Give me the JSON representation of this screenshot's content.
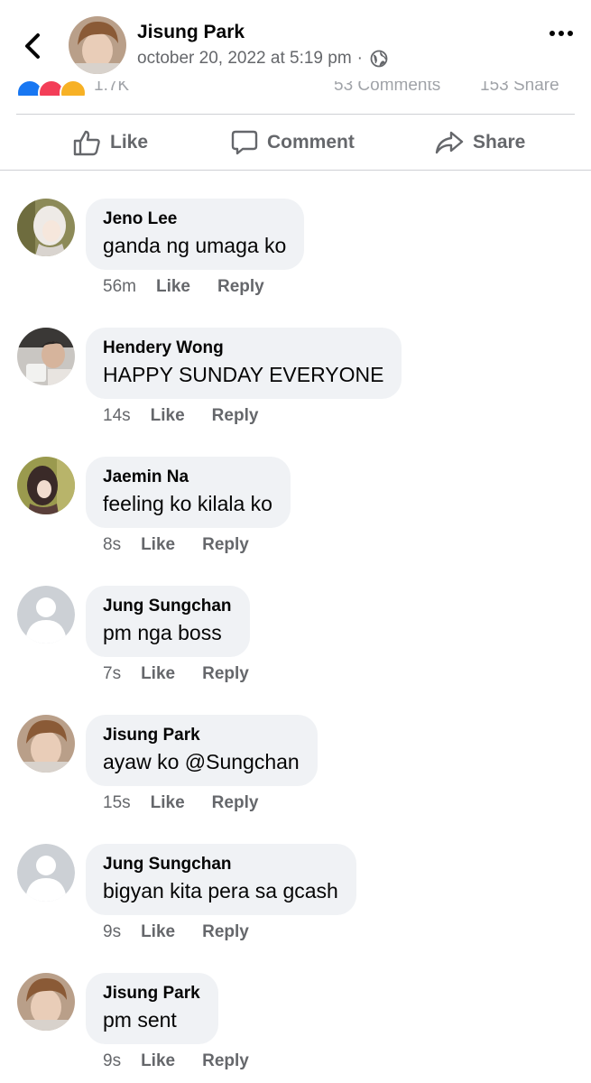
{
  "header": {
    "author": "Jisung Park",
    "timestamp": "october 20, 2022 at 5:19 pm",
    "separator": "·",
    "privacy_icon": "globe-icon"
  },
  "reactions": {
    "left_text": "1.7K",
    "comments_text": "53 Comments",
    "shares_text": "153 Share"
  },
  "actions": [
    {
      "label": "Like",
      "icon": "thumbs-up-icon"
    },
    {
      "label": "Comment",
      "icon": "comment-icon"
    },
    {
      "label": "Share",
      "icon": "share-icon"
    }
  ],
  "comments": [
    {
      "name": "Jeno Lee",
      "text": "ganda ng umaga ko",
      "time": "56m",
      "like": "Like",
      "reply": "Reply"
    },
    {
      "name": "Hendery Wong",
      "text": "HAPPY SUNDAY EVERYONE",
      "time": "14s",
      "like": "Like",
      "reply": "Reply"
    },
    {
      "name": "Jaemin Na",
      "text": "feeling ko kilala ko",
      "time": "8s",
      "like": "Like",
      "reply": "Reply"
    },
    {
      "name": "Jung Sungchan",
      "text": "pm nga boss",
      "time": "7s",
      "like": "Like",
      "reply": "Reply"
    },
    {
      "name": "Jisung Park",
      "text": "ayaw ko @Sungchan",
      "time": "15s",
      "like": "Like",
      "reply": "Reply"
    },
    {
      "name": "Jung Sungchan",
      "text": "bigyan kita pera sa gcash",
      "time": "9s",
      "like": "Like",
      "reply": "Reply"
    },
    {
      "name": "Jisung Park",
      "text": "pm sent",
      "time": "9s",
      "like": "Like",
      "reply": "Reply"
    }
  ],
  "colors": {
    "bubble": "#f0f2f5",
    "secondary_text": "#65676b",
    "like_blue": "#1877f2",
    "love_red": "#f33e58",
    "haha_yellow": "#f7b125"
  }
}
